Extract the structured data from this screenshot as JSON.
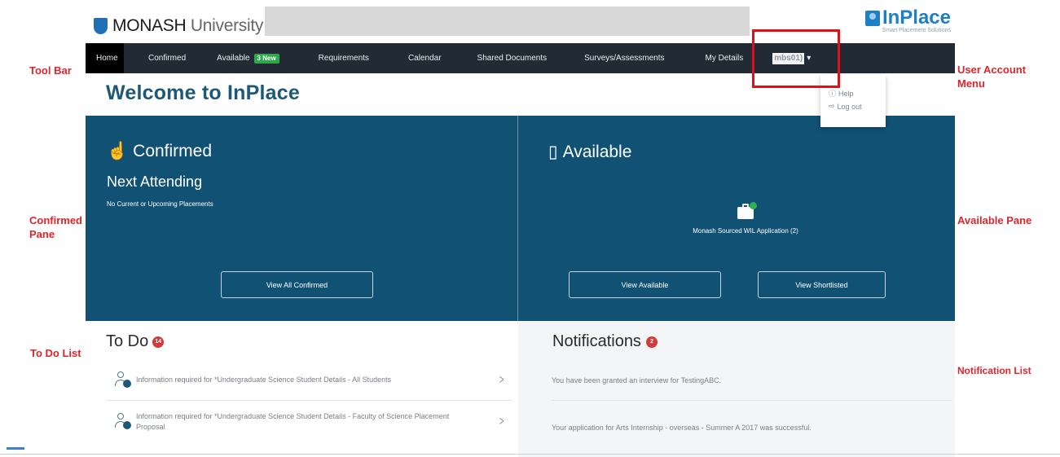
{
  "annotations": {
    "tool_bar": "Tool Bar",
    "user_account_menu": "User Account Menu",
    "confirmed_pane": "Confirmed Pane",
    "available_pane": "Available Pane",
    "to_do_list": "To Do List",
    "notification_list": "Notification List"
  },
  "header": {
    "university_bold": "MONASH",
    "university_light": " University",
    "brand_name": "InPlace",
    "brand_tagline": "Smart Placement Solutions"
  },
  "navbar": {
    "home": "Home",
    "confirmed": "Confirmed",
    "available": "Available",
    "available_badge": "3 New",
    "requirements": "Requirements",
    "calendar": "Calendar",
    "shared_documents": "Shared Documents",
    "surveys": "Surveys/Assessments",
    "my_details": "My Details",
    "user_name": "mbs01)"
  },
  "user_menu": {
    "help": "Help",
    "logout": "Log out"
  },
  "welcome": "Welcome to InPlace",
  "confirmed_pane": {
    "title": "Confirmed",
    "subtitle": "Next Attending",
    "status": "No Current or Upcoming Placements",
    "button": "View All Confirmed"
  },
  "available_pane": {
    "title": "Available",
    "item_label": "Monash Sourced WIL Application (2)",
    "button_available": "View Available",
    "button_shortlisted": "View Shortlisted"
  },
  "todo": {
    "title": "To Do",
    "badge": "14",
    "items": [
      {
        "text": "Information required for *Undergraduate Science Student Details - All Students"
      },
      {
        "text": "Information required for *Undergraduate Science Student Details - Faculty of Science Placement Proposal"
      }
    ]
  },
  "notifications": {
    "title": "Notifications",
    "badge": "2",
    "items": [
      {
        "text": "You have been granted an interview for TestingABC."
      },
      {
        "text": "Your application for Arts Internship - overseas - Summer A 2017 was successful."
      }
    ]
  },
  "colors": {
    "pane_blue": "#115174",
    "nav_dark": "#222a35",
    "annotation_red": "#e0242c",
    "brand_blue": "#1e7fc4"
  }
}
